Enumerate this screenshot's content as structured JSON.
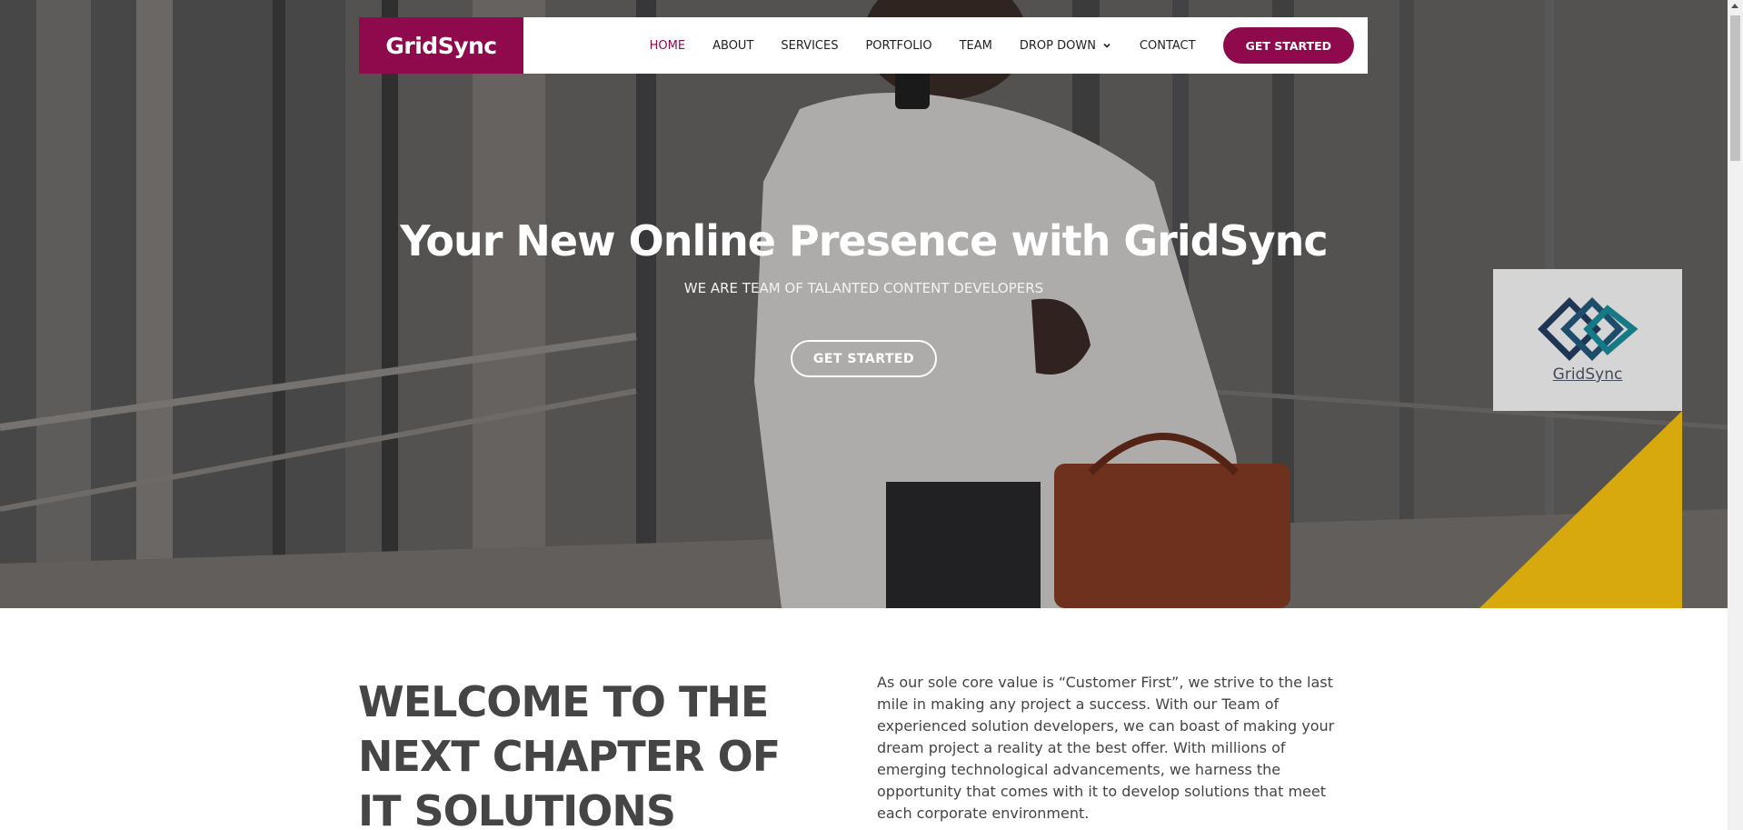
{
  "header": {
    "logo": "GridSync",
    "nav": [
      {
        "label": "HOME",
        "active": true
      },
      {
        "label": "ABOUT"
      },
      {
        "label": "SERVICES"
      },
      {
        "label": "PORTFOLIO"
      },
      {
        "label": "TEAM"
      },
      {
        "label": "DROP DOWN",
        "has_dropdown": true
      },
      {
        "label": "CONTACT"
      }
    ],
    "cta": "GET STARTED"
  },
  "hero": {
    "title": "Your New Online Presence with GridSync",
    "subtitle": "WE ARE TEAM OF TALANTED CONTENT DEVELOPERS",
    "button": "GET STARTED",
    "side_logo_label": "GridSync"
  },
  "welcome": {
    "title": "WELCOME TO THE NEXT CHAPTER OF IT SOLUTIONS",
    "text": "As our sole core value is “Customer First”, we strive to the last mile in making any project a success. With our Team of experienced solution developers, we can boast of making your dream project a reality at the best offer. With millions of emerging technological advancements, we harness the opportunity that comes with it to develop solutions that meet each corporate environment."
  },
  "colors": {
    "brand": "#8e0a4d",
    "accent_yellow": "#d7a90d",
    "logo_dark": "#1f3554",
    "logo_teal": "#157a85"
  }
}
